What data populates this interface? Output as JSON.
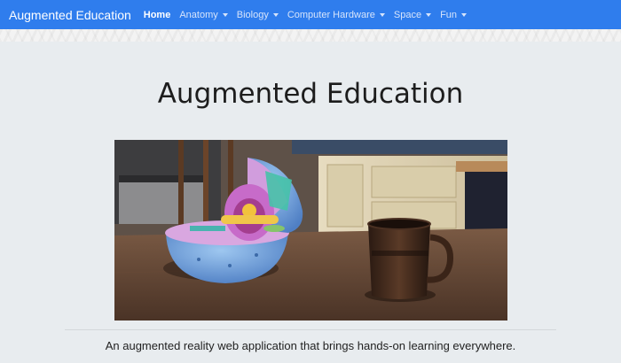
{
  "navbar": {
    "brand": "Augmented Education",
    "items": [
      {
        "label": "Home",
        "active": true,
        "dropdown": false
      },
      {
        "label": "Anatomy",
        "active": false,
        "dropdown": true
      },
      {
        "label": "Biology",
        "active": false,
        "dropdown": true
      },
      {
        "label": "Computer Hardware",
        "active": false,
        "dropdown": true
      },
      {
        "label": "Space",
        "active": false,
        "dropdown": true
      },
      {
        "label": "Fun",
        "active": false,
        "dropdown": true
      }
    ],
    "color": "#2f7ded"
  },
  "main": {
    "title": "Augmented Education",
    "hero_image": "AR 3D animal cell model on a kitchen table next to a coffee mug",
    "tagline": "An augmented reality web application that brings hands-on learning everywhere."
  }
}
